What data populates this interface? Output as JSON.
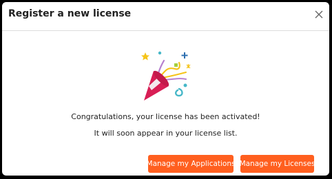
{
  "dialog": {
    "title": "Register a new license",
    "close_icon": "close-icon",
    "illustration_icon": "party-popper-icon",
    "message_primary": "Congratulations, your license has been activated!",
    "message_secondary": "It will soon appear in your license list.",
    "buttons": {
      "manage_applications": "Manage my Applications",
      "manage_licenses": "Manage my Licenses"
    }
  },
  "colors": {
    "accent": "#ff5f1f",
    "popper_red": "#d81e55",
    "popper_light": "#f3e9ee",
    "confetti_yellow": "#f5c419",
    "confetti_teal": "#46b7c8",
    "confetti_blue": "#2d6fb0",
    "confetti_purple": "#b67fcf",
    "confetti_lime": "#a5cf3a"
  }
}
